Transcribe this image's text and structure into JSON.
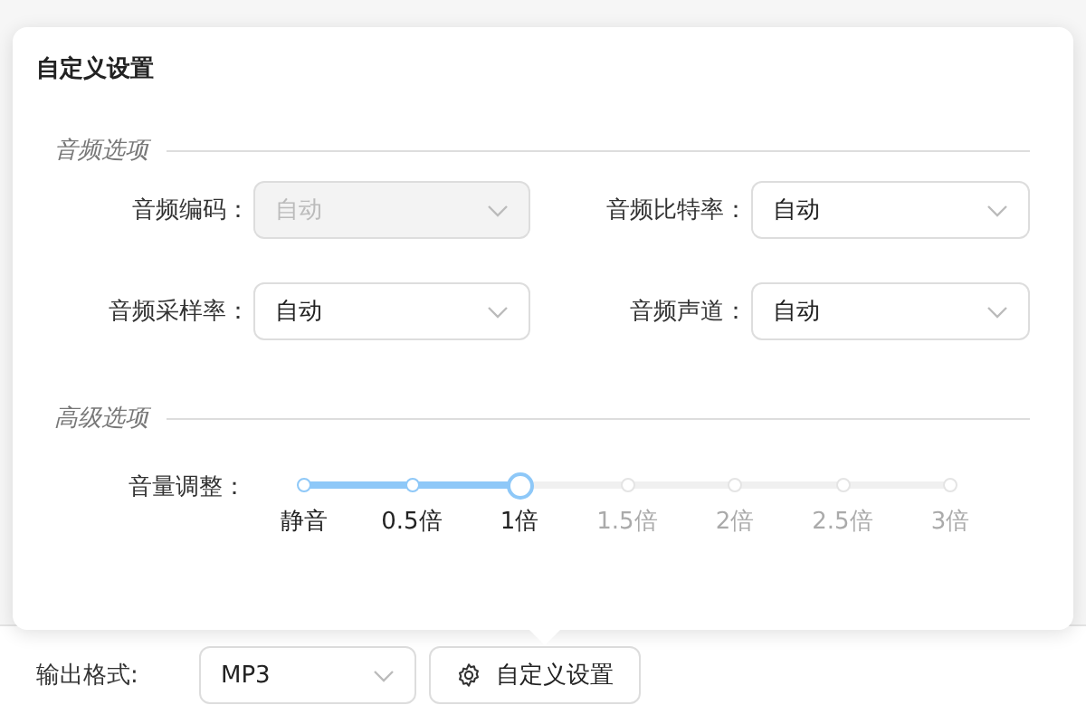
{
  "popover": {
    "title": "自定义设置",
    "sections": [
      {
        "title": "音频选项",
        "fields": [
          {
            "label": "音频编码：",
            "value": "自动",
            "disabled": true
          },
          {
            "label": "音频比特率：",
            "value": "自动",
            "disabled": false
          },
          {
            "label": "音频采样率：",
            "value": "自动",
            "disabled": false
          },
          {
            "label": "音频声道：",
            "value": "自动",
            "disabled": false
          }
        ]
      },
      {
        "title": "高级选项",
        "slider": {
          "label": "音量调整：",
          "level": 0.3333,
          "marks": [
            "静音",
            "0.5倍",
            "1倍",
            "1.5倍",
            "2倍",
            "2.5倍",
            "3倍"
          ]
        }
      }
    ]
  },
  "footer": {
    "label": "输出格式:",
    "format": "MP3",
    "button": "自定义设置"
  }
}
